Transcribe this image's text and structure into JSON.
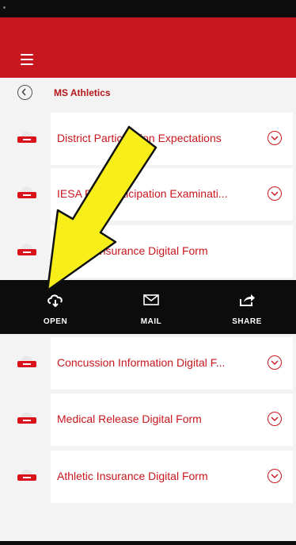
{
  "breadcrumb": {
    "title": "MS Athletics"
  },
  "documents_top": [
    {
      "label": "District Participation Expectations"
    },
    {
      "label": "IESA Pre-Participation Examinati..."
    },
    {
      "label": "Athletic Insurance Digital Form"
    }
  ],
  "actions": [
    {
      "label": "OPEN",
      "icon": "cloud-download-icon"
    },
    {
      "label": "MAIL",
      "icon": "mail-icon"
    },
    {
      "label": "SHARE",
      "icon": "share-icon"
    }
  ],
  "documents_bottom": [
    {
      "label": "Concussion Information Digital F..."
    },
    {
      "label": "Medical Release Digital Form"
    },
    {
      "label": "Athletic Insurance Digital Form"
    }
  ],
  "colors": {
    "header": "#c8171e",
    "accent": "#d9121b",
    "action_bar": "#0c0c0c",
    "annotation_arrow": "#f7ee1a"
  }
}
